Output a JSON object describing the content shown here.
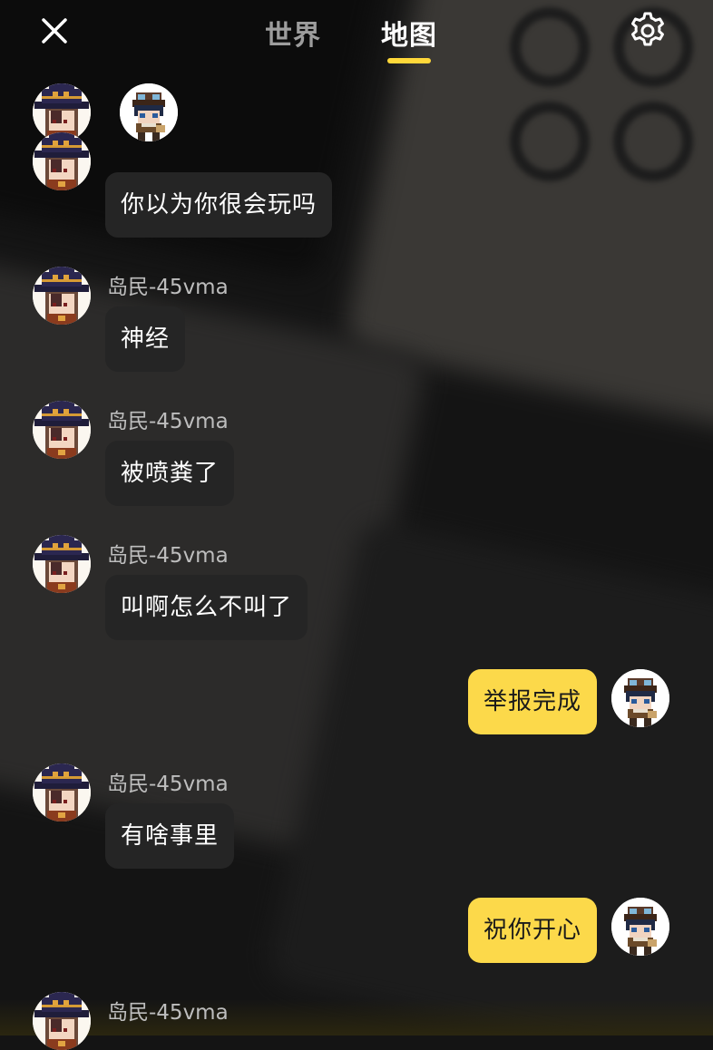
{
  "header": {
    "tabs": [
      {
        "label": "世界",
        "active": false
      },
      {
        "label": "地图",
        "active": true
      }
    ],
    "icons": {
      "close": "close-icon",
      "settings": "gear-icon"
    },
    "accent_color": "#ffd83a"
  },
  "online_users": [
    {
      "avatar": "witch-hat-avatar"
    },
    {
      "avatar": "goggles-boy-avatar"
    }
  ],
  "messages": [
    {
      "side": "in",
      "sender": "",
      "text": "你以为你很会玩吗"
    },
    {
      "side": "in",
      "sender": "岛民-45vma",
      "text": "神经"
    },
    {
      "side": "in",
      "sender": "岛民-45vma",
      "text": "被喷粪了"
    },
    {
      "side": "in",
      "sender": "岛民-45vma",
      "text": "叫啊怎么不叫了"
    },
    {
      "side": "out",
      "sender": "",
      "text": "举报完成"
    },
    {
      "side": "in",
      "sender": "岛民-45vma",
      "text": "有啥事里"
    },
    {
      "side": "out",
      "sender": "",
      "text": "祝你开心"
    },
    {
      "side": "in",
      "sender": "岛民-45vma",
      "text": ""
    }
  ],
  "colors": {
    "incoming_bubble": "#252525",
    "outgoing_bubble": "#fcd94a",
    "sender_name": "#bdbdbd"
  }
}
